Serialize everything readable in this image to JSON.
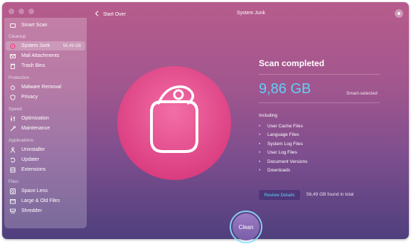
{
  "window": {
    "title": "System Junk",
    "back_label": "Start Over"
  },
  "sidebar": {
    "top_item": {
      "label": "Smart Scan",
      "icon": "smart-scan-icon"
    },
    "sections": [
      {
        "label": "Cleanup"
      },
      {
        "label": "Protection"
      },
      {
        "label": "Speed"
      },
      {
        "label": "Applications"
      },
      {
        "label": "Files"
      }
    ],
    "items": [
      {
        "label": "System Junk",
        "size": "56,49 GB",
        "icon": "system-junk-icon",
        "active": true
      },
      {
        "label": "Mail Attachments",
        "icon": "mail-icon"
      },
      {
        "label": "Trash Bins",
        "icon": "trash-icon"
      },
      {
        "label": "Malware Removal",
        "icon": "malware-icon"
      },
      {
        "label": "Privacy",
        "icon": "privacy-icon"
      },
      {
        "label": "Optimization",
        "icon": "optimization-icon"
      },
      {
        "label": "Maintenance",
        "icon": "maintenance-icon"
      },
      {
        "label": "Uninstaller",
        "icon": "uninstaller-icon"
      },
      {
        "label": "Updater",
        "icon": "updater-icon"
      },
      {
        "label": "Extensions",
        "icon": "extensions-icon"
      },
      {
        "label": "Space Lens",
        "icon": "space-lens-icon"
      },
      {
        "label": "Large & Old Files",
        "icon": "large-files-icon"
      },
      {
        "label": "Shredder",
        "icon": "shredder-icon"
      }
    ]
  },
  "result": {
    "heading": "Scan completed",
    "size": "9,86 GB",
    "smart_label": "Smart-selected",
    "including_label": "Including",
    "included": [
      "User Cache Files",
      "Language Files",
      "System Log Files",
      "User Log Files",
      "Document Versions",
      "Downloads"
    ],
    "review_label": "Review Details",
    "found_text": "56,49 GB found in total"
  },
  "clean": {
    "label": "Clean"
  },
  "colors": {
    "accent": "#5fd1f7",
    "hero_pink": "#e8448a"
  }
}
